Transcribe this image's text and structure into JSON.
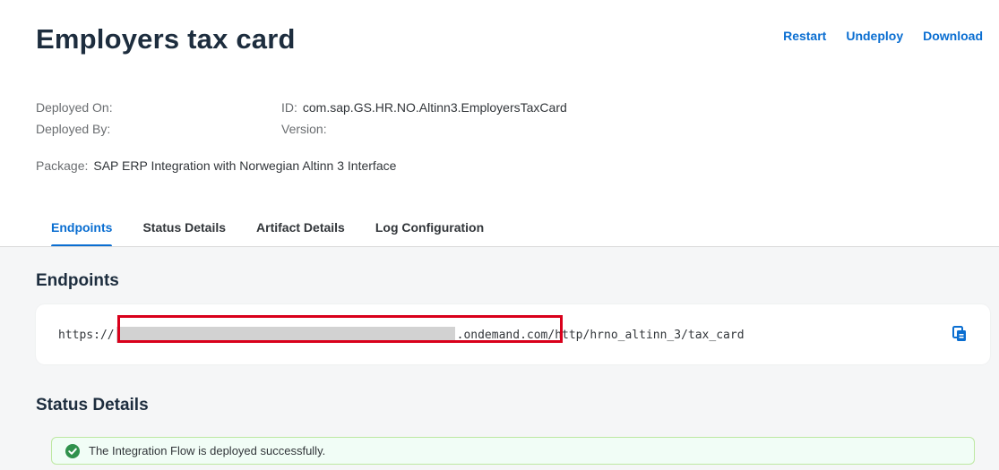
{
  "header": {
    "title": "Employers tax card",
    "actions": [
      "Restart",
      "Undeploy",
      "Download"
    ]
  },
  "meta": {
    "deployed_on_label": "Deployed On:",
    "deployed_by_label": "Deployed By:",
    "id_label": "ID:",
    "id_value": "com.sap.GS.HR.NO.Altinn3.EmployersTaxCard",
    "version_label": "Version:",
    "package_label": "Package:",
    "package_value": "SAP ERP Integration with Norwegian Altinn 3 Interface"
  },
  "tabs": [
    {
      "label": "Endpoints",
      "active": true
    },
    {
      "label": "Status Details",
      "active": false
    },
    {
      "label": "Artifact Details",
      "active": false
    },
    {
      "label": "Log Configuration",
      "active": false
    }
  ],
  "endpoints": {
    "title": "Endpoints",
    "url_prefix": "https://",
    "url_domain_suffix": ".ondemand.com",
    "url_path": "/http/hrno_altinn_3/tax_card",
    "copy_icon": "copy-icon"
  },
  "status": {
    "title": "Status Details",
    "message": "The Integration Flow is deployed successfully.",
    "icon": "success-check-icon",
    "color": "#30914c"
  },
  "colors": {
    "accent": "#0a6ed1",
    "highlight": "#d9001b"
  }
}
